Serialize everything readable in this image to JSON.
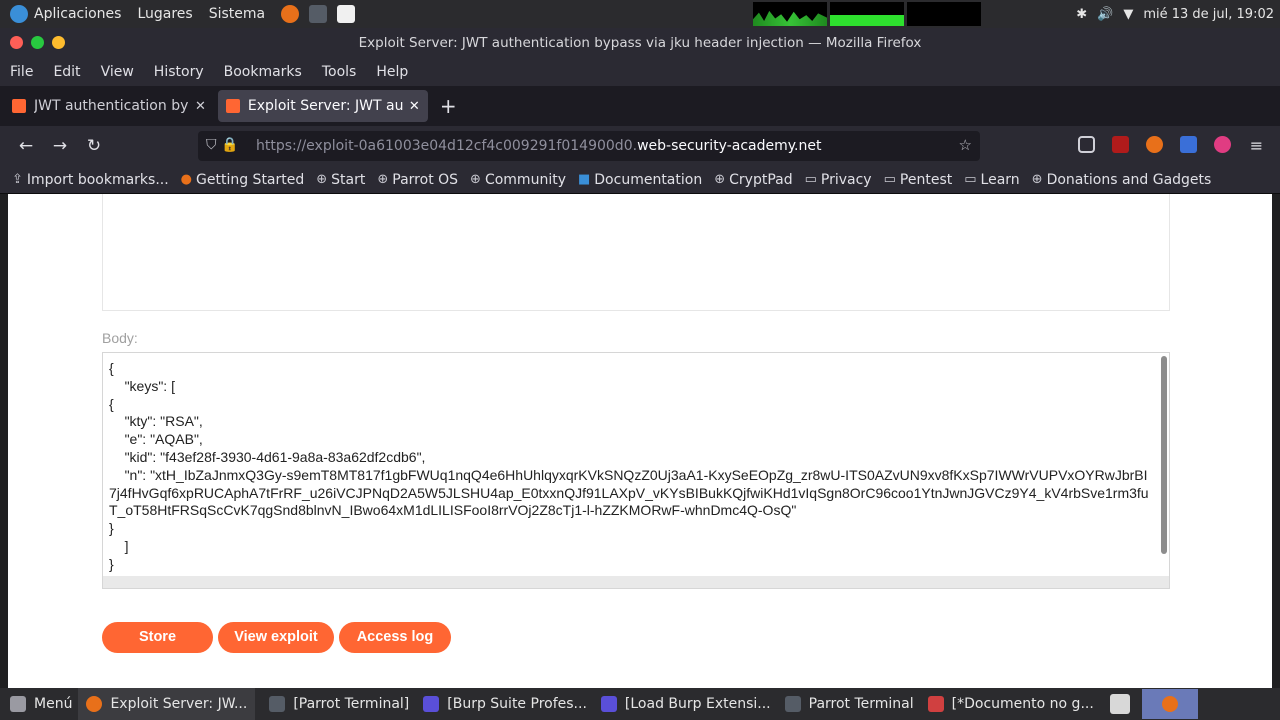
{
  "os_bar": {
    "apps": "Aplicaciones",
    "places": "Lugares",
    "system": "Sistema",
    "datetime": "mié 13 de jul, 19:02"
  },
  "window": {
    "title": "Exploit Server: JWT authentication bypass via jku header injection — Mozilla Firefox"
  },
  "menu": [
    "File",
    "Edit",
    "View",
    "History",
    "Bookmarks",
    "Tools",
    "Help"
  ],
  "tabs": [
    {
      "title": "JWT authentication bypass"
    },
    {
      "title": "Exploit Server: JWT authe"
    }
  ],
  "url": {
    "prefix": "https://exploit-0a61003e04d12cf4c009291f014900d0.",
    "domain": "web-security-academy.net"
  },
  "bookmarks": [
    {
      "icon": "import-icon",
      "label": "Import bookmarks..."
    },
    {
      "icon": "firefox-icon",
      "label": "Getting Started"
    },
    {
      "icon": "globe-icon",
      "label": "Start"
    },
    {
      "icon": "globe-icon",
      "label": "Parrot OS"
    },
    {
      "icon": "globe-icon",
      "label": "Community"
    },
    {
      "icon": "doc-icon",
      "label": "Documentation"
    },
    {
      "icon": "globe-icon",
      "label": "CryptPad"
    },
    {
      "icon": "folder-icon",
      "label": "Privacy"
    },
    {
      "icon": "folder-icon",
      "label": "Pentest"
    },
    {
      "icon": "folder-icon",
      "label": "Learn"
    },
    {
      "icon": "globe-icon",
      "label": "Donations and Gadgets"
    }
  ],
  "form": {
    "body_label": "Body:",
    "body_value": "{\n    \"keys\": [\n{\n    \"kty\": \"RSA\",\n    \"e\": \"AQAB\",\n    \"kid\": \"f43ef28f-3930-4d61-9a8a-83a62df2cdb6\",\n    \"n\": \"xtH_IbZaJnmxQ3Gy-s9emT8MT817f1gbFWUq1nqQ4e6HhUhlqyxqrKVkSNQzZ0Uj3aA1-KxySeEOpZg_zr8wU-ITS0AZvUN9xv8fKxSp7IWWrVUPVxOYRwJbrBI7j4fHvGqf6xpRUCAphA7tFrRF_u26iVCJPNqD2A5W5JLSHU4ap_E0txxnQJf91LAXpV_vKYsBIBukKQjfwiKHd1vIqSgn8OrC96coo1YtnJwnJGVCz9Y4_kV4rbSve1rm3fuT_oT58HtFRSqScCvK7qgSnd8blnvN_IBwo64xM1dLILISFooI8rrVOj2Z8cTj1-l-hZZKMORwF-whnDmc4Q-OsQ\"\n}\n    ]\n}",
    "buttons": {
      "store": "Store",
      "view": "View exploit",
      "log": "Access log"
    }
  },
  "taskbar": [
    {
      "label": "Menú"
    },
    {
      "label": "Exploit Server: JW..."
    },
    {
      "label": "[Parrot Terminal]"
    },
    {
      "label": "[Burp Suite Profes..."
    },
    {
      "label": "[Load Burp Extensi..."
    },
    {
      "label": "Parrot Terminal"
    },
    {
      "label": "[*Documento no g..."
    }
  ],
  "colors": {
    "accent": "#ff6633",
    "chrome": "#2b2a33"
  }
}
